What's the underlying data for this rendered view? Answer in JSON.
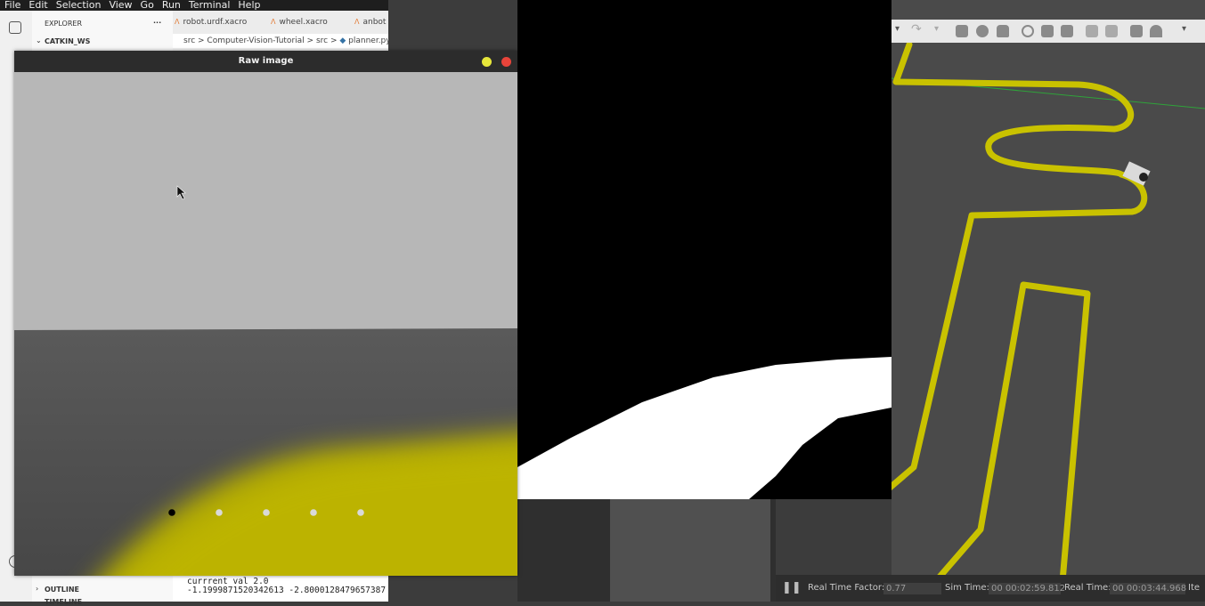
{
  "menu": [
    "File",
    "Edit",
    "Selection",
    "View",
    "Go",
    "Run",
    "Terminal",
    "Help"
  ],
  "sidebar": {
    "explorer_label": "EXPLORER",
    "more_glyph": "···",
    "workspace": "CATKIN_WS",
    "outline": "OUTLINE",
    "timeline": "TIMELINE"
  },
  "editor_tabs": [
    "robot.urdf.xacro",
    "wheel.xacro",
    "anbot"
  ],
  "breadcrumb": [
    "src",
    "Computer-Vision-Tutorial",
    "src",
    "planner.py"
  ],
  "terminal": {
    "line1": "currrent val 2.0",
    "line2": "-1.1999871520342613 -2.8000128479657387"
  },
  "raw_window": {
    "title": "Raw image",
    "dots": [
      {
        "color": "#000000"
      },
      {
        "color": "#d9d9d9"
      },
      {
        "color": "#d9d9d9"
      },
      {
        "color": "#d9d9d9"
      },
      {
        "color": "#d9d9d9"
      }
    ]
  },
  "gazebo": {
    "rtf_label": "Real Time Factor:",
    "rtf_value": "0.77",
    "sim_label": "Sim Time:",
    "sim_value": "00 00:02:59.812",
    "real_label": "Real Time:",
    "real_value": "00 00:03:44.968",
    "iter_label": "Ite"
  },
  "colors": {
    "track_yellow": "#c9c200",
    "sky_gray": "#b7b7b7",
    "floor_gray": "#5a5a5a",
    "close_red": "#e8443a",
    "minimize_yellow": "#e6e63a"
  }
}
